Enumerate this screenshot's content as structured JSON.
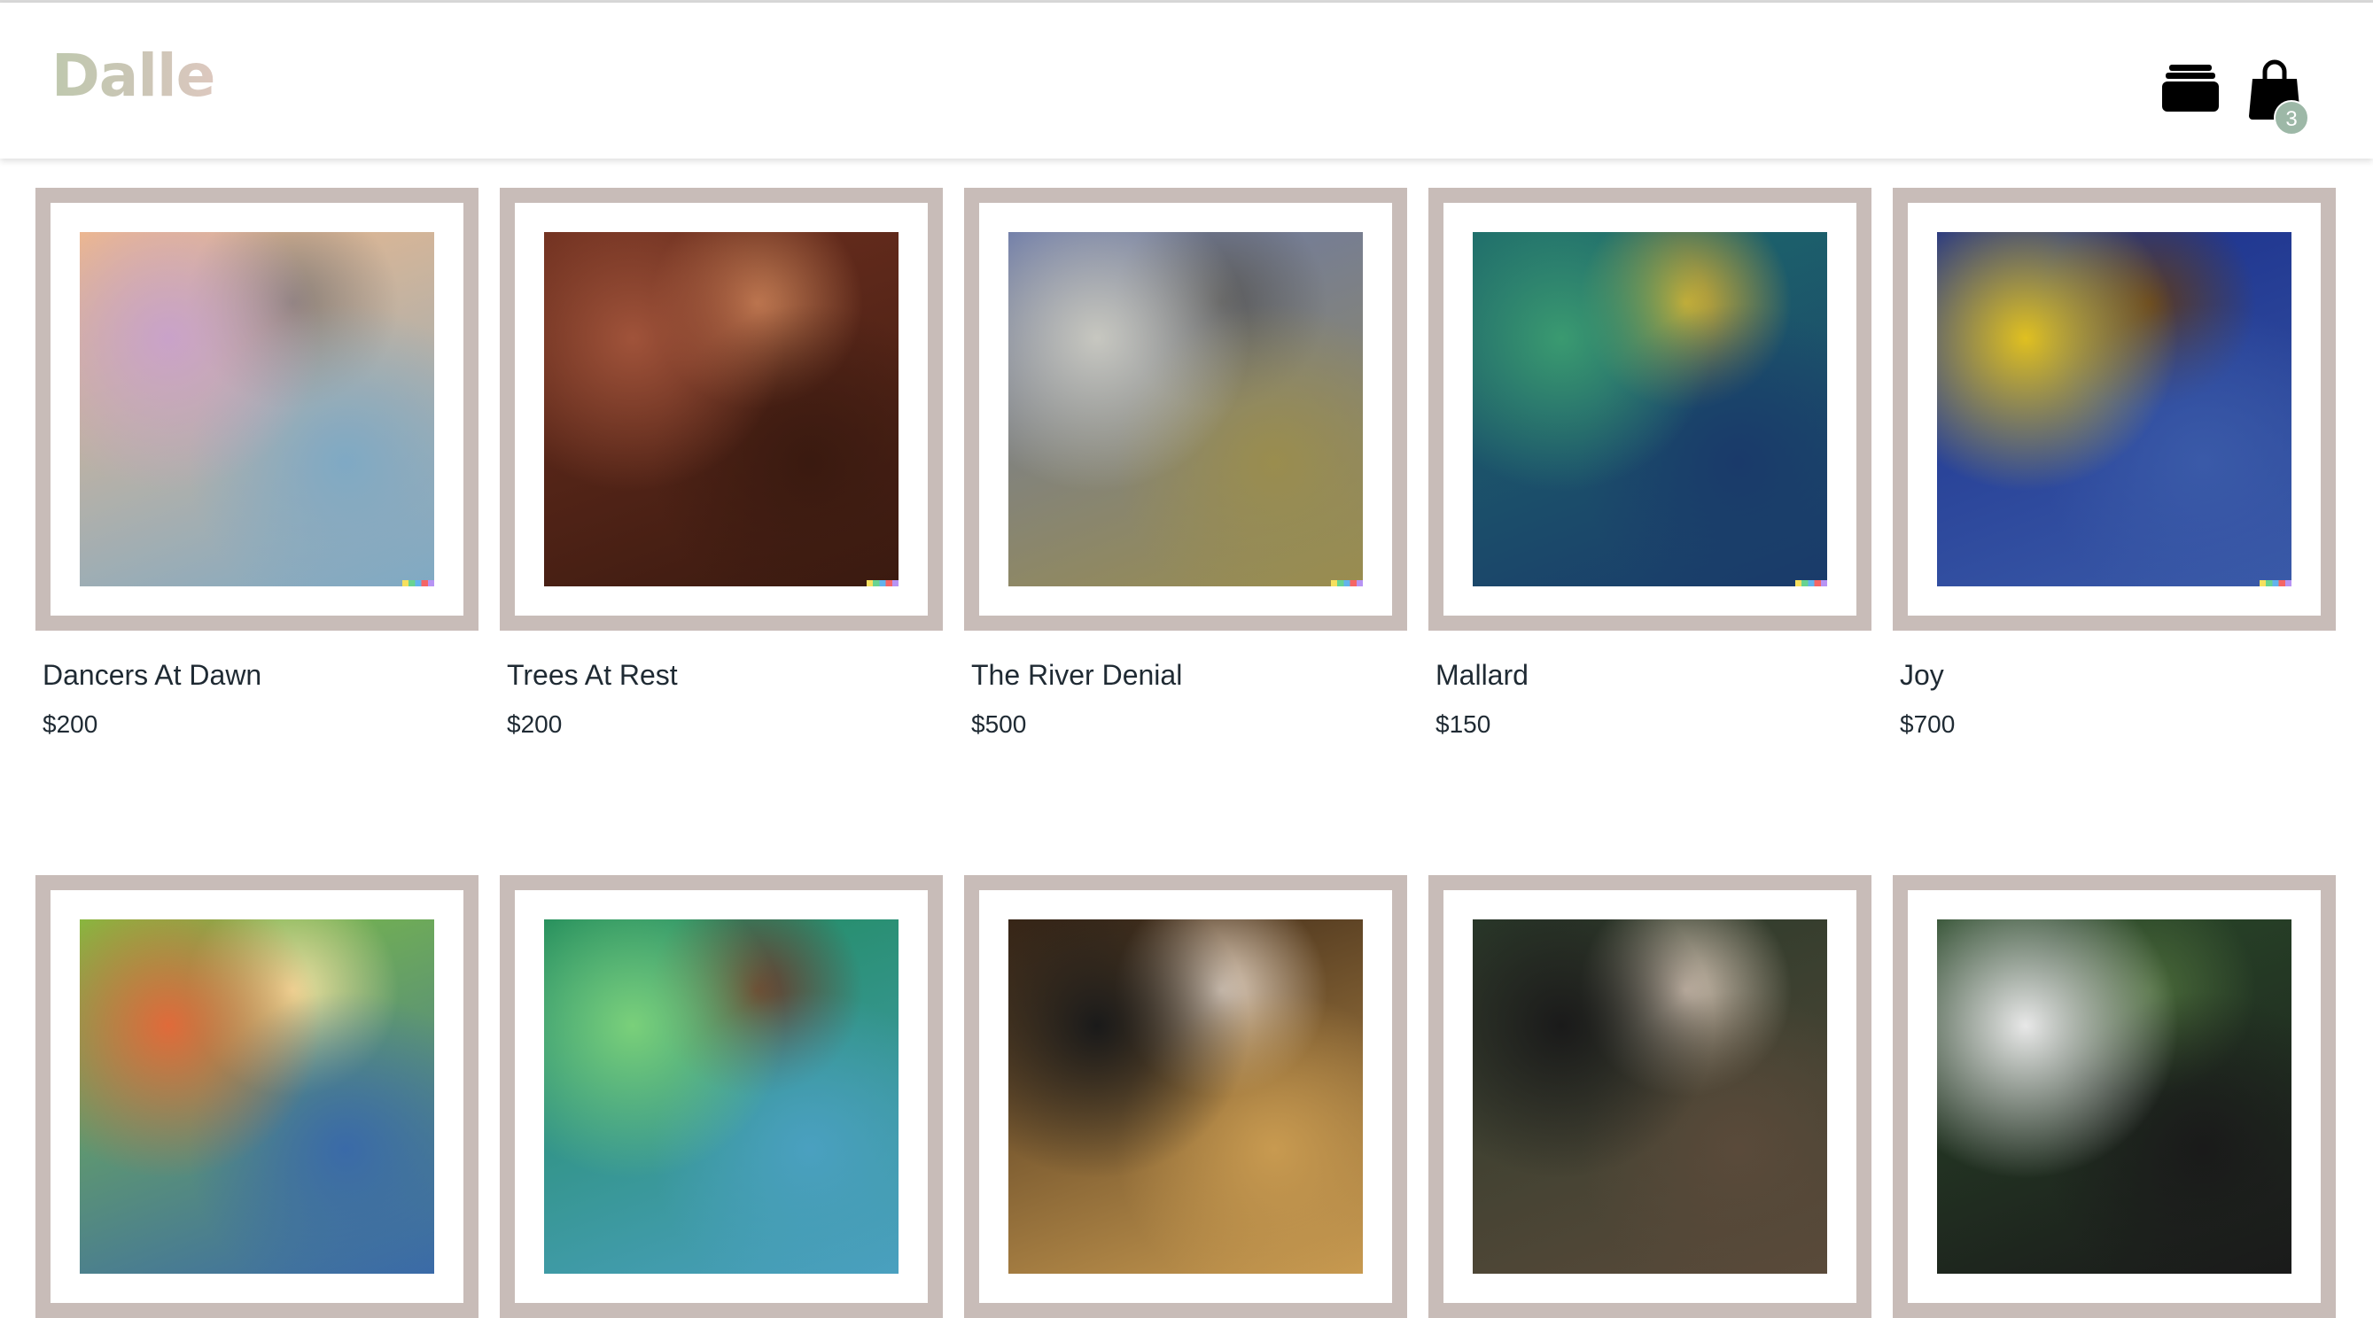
{
  "brand": {
    "logo": "Dalle"
  },
  "header": {
    "gallery_icon": "gallery-stack-icon",
    "cart_icon": "shopping-bag-icon",
    "cart_count": "3"
  },
  "products": [
    {
      "title": "Dancers At Dawn",
      "price": "$200",
      "palette": [
        "#f0b98a",
        "#c9a2c9",
        "#7fa9c4",
        "#8a7f78"
      ]
    },
    {
      "title": "Trees At Rest",
      "price": "$200",
      "palette": [
        "#6e2f1f",
        "#a0533a",
        "#3a1a10",
        "#c07a52"
      ]
    },
    {
      "title": "The River Denial",
      "price": "$500",
      "palette": [
        "#6b79a8",
        "#c7c7c0",
        "#9a8d4e",
        "#5a5a5a"
      ]
    },
    {
      "title": "Mallard",
      "price": "$150",
      "palette": [
        "#1d6b6b",
        "#3a9a70",
        "#1a3a6a",
        "#d8b030"
      ]
    },
    {
      "title": "Joy",
      "price": "$700",
      "palette": [
        "#1a2e8a",
        "#e0c020",
        "#3a5aa8",
        "#5a3a20"
      ]
    },
    {
      "title": "",
      "price": "",
      "palette": [
        "#7fbf3f",
        "#e06a3a",
        "#3a6aa8",
        "#f0e0a0"
      ]
    },
    {
      "title": "",
      "price": "",
      "palette": [
        "#1f8a5a",
        "#7ad07a",
        "#4aa0c0",
        "#6a3a2a"
      ]
    },
    {
      "title": "",
      "price": "",
      "palette": [
        "#3a2616",
        "#1a1a1a",
        "#c89a50",
        "#e0d0c0"
      ]
    },
    {
      "title": "",
      "price": "",
      "palette": [
        "#2a3a2a",
        "#1a1a1a",
        "#5a4a3a",
        "#d0c0b0"
      ]
    },
    {
      "title": "",
      "price": "",
      "palette": [
        "#2a4a2a",
        "#e8e8e8",
        "#1a1a1a",
        "#4a6a3a"
      ]
    }
  ]
}
